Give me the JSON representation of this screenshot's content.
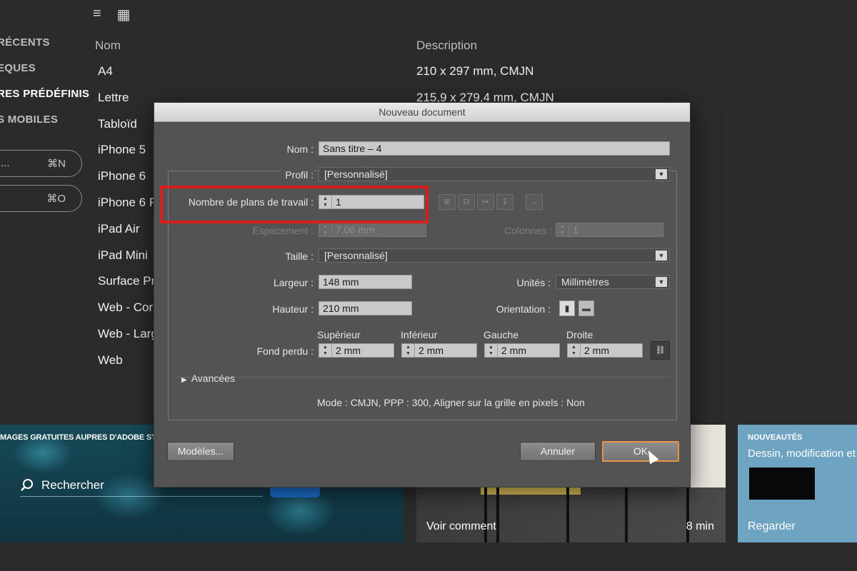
{
  "toolbar": {
    "list_view_icon": "≡",
    "grid_view_icon": "▦"
  },
  "left_nav": {
    "items": [
      {
        "label": "RÉCENTS"
      },
      {
        "label": "EQUES"
      },
      {
        "label": "RES PRÉDÉFINIS"
      },
      {
        "label": "S MOBILES"
      }
    ],
    "pill1": {
      "label": "...",
      "shortcut": "⌘N"
    },
    "pill2": {
      "label": "",
      "shortcut": "⌘O"
    }
  },
  "presets_table": {
    "headers": {
      "name": "Nom",
      "description": "Description"
    },
    "names": [
      "A4",
      "Lettre",
      "Tabloïd",
      "iPhone 5",
      "iPhone 6",
      "iPhone 6 P",
      "iPad Air",
      "iPad Mini",
      "Surface Pr",
      "Web - Cor",
      "Web - Larg",
      "Web"
    ],
    "descriptions": [
      "210 x 297 mm, CMJN",
      "215,9 x 279,4 mm, CMJN"
    ]
  },
  "cards": {
    "stock": {
      "tag": "MAGES GRATUITES AUPRES D'ADOBE STOCK",
      "search_label": "Rechercher"
    },
    "video": {
      "cta": "Voir comment",
      "duration": "8 min"
    },
    "news": {
      "tag": "NOUVEAUTÉS",
      "title": "Dessin, modification et",
      "cta": "Regarder"
    }
  },
  "dialog": {
    "title": "Nouveau document",
    "name_label": "Nom :",
    "name_value": "Sans titre – 4",
    "profile_label": "Profil :",
    "profile_value": "[Personnalisé]",
    "artboards_label": "Nombre de plans de travail :",
    "artboards_value": "1",
    "spacing_label": "Espacement :",
    "spacing_value": "7,06 mm",
    "columns_label": "Colonnes :",
    "columns_value": "1",
    "size_label": "Taille :",
    "size_value": "[Personnalisé]",
    "width_label": "Largeur :",
    "width_value": "148 mm",
    "units_label": "Unités :",
    "units_value": "Millimètres",
    "height_label": "Hauteur :",
    "height_value": "210 mm",
    "orientation_label": "Orientation :",
    "bleed_label": "Fond perdu :",
    "bleed": {
      "top_label": "Supérieur",
      "top_value": "2 mm",
      "bottom_label": "Inférieur",
      "bottom_value": "2 mm",
      "left_label": "Gauche",
      "left_value": "2 mm",
      "right_label": "Droite",
      "right_value": "2 mm"
    },
    "advanced_label": "Avancées",
    "summary": "Mode : CMJN, PPP : 300, Aligner sur la grille en pixels : Non",
    "templates_button": "Modèles...",
    "cancel_button": "Annuler",
    "ok_button": "OK"
  },
  "colors": {
    "highlight": "#d81f1f",
    "ok_focus": "#e8954a",
    "dialog_bg": "#535353"
  }
}
